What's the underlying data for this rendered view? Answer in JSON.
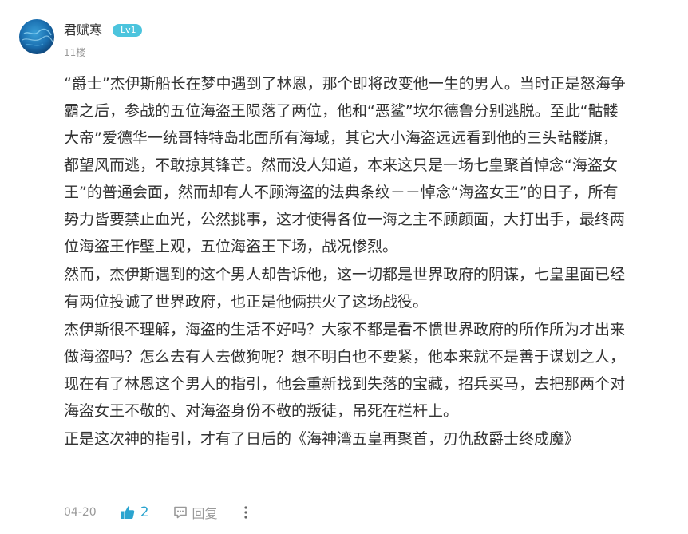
{
  "post": {
    "author": {
      "name": "君赋寒",
      "level": "Lv1"
    },
    "floor": "11楼",
    "paragraphs": [
      "“爵士”杰伊斯船长在梦中遇到了林恩，那个即将改变他一生的男人。当时正是怒海争\n霸之后，参战的五位海盗王陨落了两位，他和“恶鲨”坎尔德鲁分别逃脱。至此“骷髅\n大帝”爱德华一统哥特特岛北面所有海域，其它大小海盗远远看到他的三头骷髅旗，\n都望风而逃，不敢掠其锋芒。然而没人知道，本来这只是一场七皇聚首悼念“海盗女\n王”的普通会面，然而却有人不顾海盗的法典条纹－－悼念“海盗女王”的日子，所有\n势力皆要禁止血光，公然挑事，这才使得各位一海之主不顾颜面，大打出手，最终两\n位海盗王作壁上观，五位海盗王下场，战况惨烈。",
      "然而，杰伊斯遇到的这个男人却告诉他，这一切都是世界政府的阴谋，七皇里面已经\n有两位投诚了世界政府，也正是他俩拱火了这场战役。",
      "杰伊斯很不理解，海盗的生活不好吗？大家不都是看不惯世界政府的所作所为才出来\n做海盗吗？怎么去有人去做狗呢？想不明白也不要紧，他本来就不是善于谋划之人，\n现在有了林恩这个男人的指引，他会重新找到失落的宝藏，招兵买马，去把那两个对\n海盗女王不敬的、对海盗身份不敬的叛徒，吊死在栏杆上。",
      "正是这次神的指引，才有了日后的《海神湾五皇再聚首，刃仇敌爵士终成魔》"
    ],
    "footer": {
      "date": "04-20",
      "like_count": "2",
      "reply_label": "回复"
    },
    "icons": {
      "avatar": "avatar-image",
      "like": "thumbs-up-icon",
      "reply": "comment-icon",
      "more": "more-vertical-icon"
    },
    "colors": {
      "level_badge": "#4cc4dd",
      "like_accent": "#2ba4cf",
      "text": "#333333",
      "muted": "#999999"
    }
  }
}
